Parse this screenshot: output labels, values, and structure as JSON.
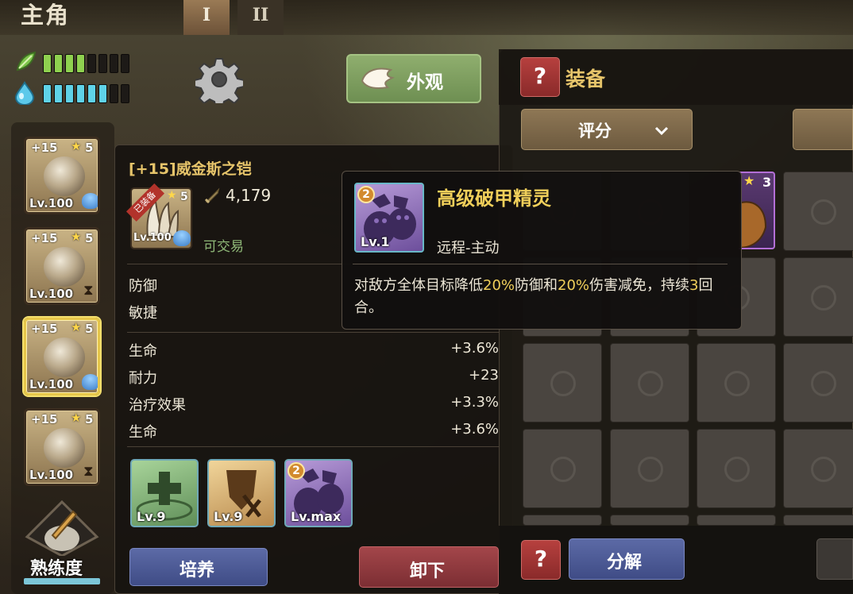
{
  "header": {
    "title": "主角",
    "tabs": [
      "I",
      "II"
    ]
  },
  "resources": {
    "stamina_filled": 4,
    "stamina_total": 8,
    "water_filled": 6,
    "water_total": 8,
    "colors": {
      "stamina": "#8fd14f",
      "water": "#5fd3e8",
      "empty": "#1d1a17"
    }
  },
  "outfit_button": {
    "label": "外观",
    "icon": "angel-wings-icon"
  },
  "settings_icon": "gear-icon",
  "equipment_slots": [
    {
      "plus": "+15",
      "stars": "5",
      "level": "Lv.100",
      "icon": "claw-gauntlet-icon",
      "badge": "shell-icon",
      "selected": false
    },
    {
      "plus": "+15",
      "stars": "5",
      "level": "Lv.100",
      "icon": "spiky-helmet-icon",
      "badge": "hourglass-icon",
      "selected": false
    },
    {
      "plus": "+15",
      "stars": "5",
      "level": "Lv.100",
      "icon": "claw-armor-icon",
      "badge": "shell-icon",
      "selected": true
    },
    {
      "plus": "+15",
      "stars": "5",
      "level": "Lv.100",
      "icon": "ring-necklace-icon",
      "badge": "hourglass-icon",
      "selected": false
    }
  ],
  "proficiency": {
    "label": "熟练度",
    "progress": 1.0
  },
  "item_detail": {
    "name": "[+15]威金斯之铠",
    "equipped_ribbon": "已装备",
    "stars": "5",
    "level": "Lv.100",
    "power": "4,179",
    "tradable": "可交易",
    "base_stats": [
      {
        "name": "防御",
        "value": ""
      },
      {
        "name": "敏捷",
        "value": ""
      }
    ],
    "extra_stats": [
      {
        "name": "生命",
        "value": "+3.6%"
      },
      {
        "name": "耐力",
        "value": "+23"
      },
      {
        "name": "治疗效果",
        "value": "+3.3%"
      },
      {
        "name": "生命",
        "value": "+3.6%"
      }
    ],
    "skills": [
      {
        "level": "Lv.9",
        "icon": "heal-cross-icon",
        "badge": ""
      },
      {
        "level": "Lv.9",
        "icon": "broken-shield-icon",
        "badge": ""
      },
      {
        "level": "Lv.max",
        "icon": "armor-break-spirit-icon",
        "badge": "2"
      }
    ],
    "train_label": "培养",
    "unequip_label": "卸下"
  },
  "tooltip": {
    "badge": "2",
    "level": "Lv.1",
    "title": "高级破甲精灵",
    "type": "远程-主动",
    "desc_parts": [
      "对敌方全体目标降低",
      "20%",
      "防御和",
      "20%",
      "伤害减免，持续",
      "3",
      "回合。"
    ]
  },
  "inventory": {
    "help_label": "?",
    "title": "装备",
    "sort_label": "评分",
    "item": {
      "stars": "3"
    },
    "disassemble_label": "分解"
  }
}
